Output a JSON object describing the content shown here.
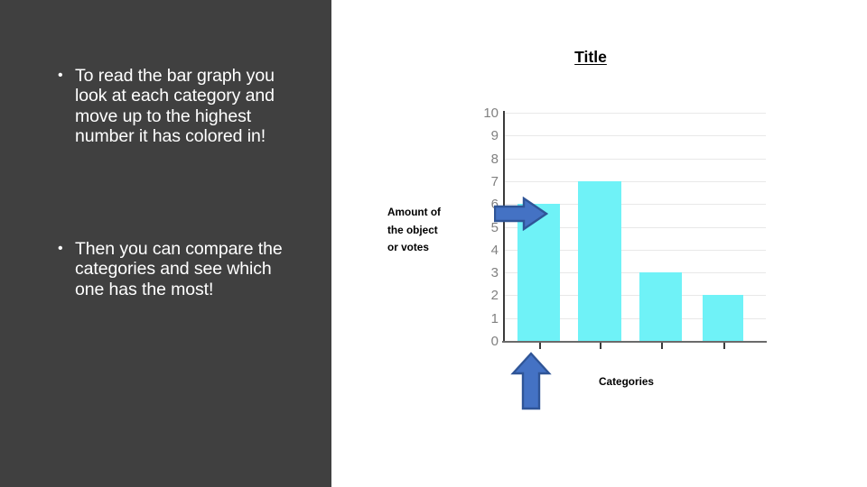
{
  "slide": {
    "background_color": "#FFFFFF",
    "panel_color": "#404040"
  },
  "sidebar": {
    "bullets": [
      {
        "text": "To read the bar graph you look at each category and move up to the highest number it has colored in!"
      },
      {
        "text": "Then you can compare the categories and see which one has the most!"
      }
    ]
  },
  "annotations": {
    "value_arrow_name": "right-arrow",
    "category_arrow_name": "up-arrow",
    "arrow_fill": "#4472C4",
    "arrow_stroke": "#2F5597"
  },
  "chart_data": {
    "type": "bar",
    "title": "Title",
    "xlabel": "Categories",
    "ylabel": "Amount of\nthe object\nor votes",
    "categories": [
      "",
      "",
      "",
      ""
    ],
    "values": [
      6,
      7,
      3,
      2
    ],
    "ylim": [
      0,
      10
    ],
    "y_ticks": [
      10,
      9,
      8,
      7,
      6,
      5,
      4,
      3,
      2,
      1,
      0
    ],
    "grid": true,
    "legend": false,
    "bar_color": "#6FF2F7",
    "gridline_color": "#E8E8E8",
    "axis_color": "#3B3B3B",
    "tick_label_color": "#808080"
  }
}
